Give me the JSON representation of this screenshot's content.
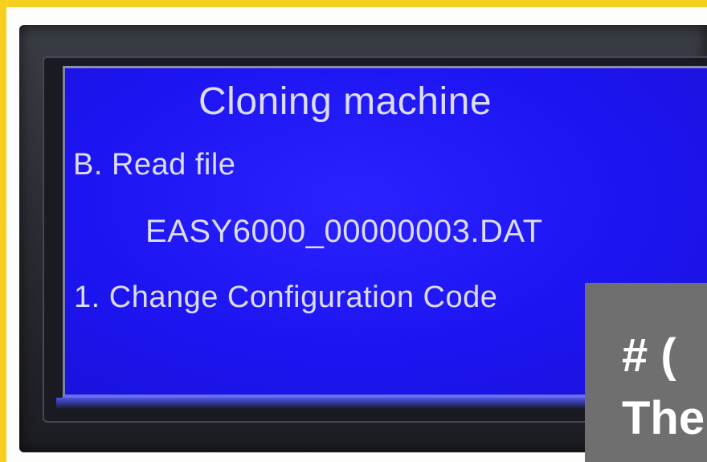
{
  "screen": {
    "title": "Cloning machine",
    "line_b": "B. Read file",
    "filename": "EASY6000_00000003.DAT",
    "line_1": "1. Change Configuration Code"
  },
  "overlay": {
    "line_1": "# (",
    "line_2": "The"
  },
  "colors": {
    "lcd_background": "#1d14f2",
    "lcd_text": "#dcdcf6",
    "frame_yellow": "#f7cf1e",
    "overlay_gray": "#6f6f6f"
  }
}
